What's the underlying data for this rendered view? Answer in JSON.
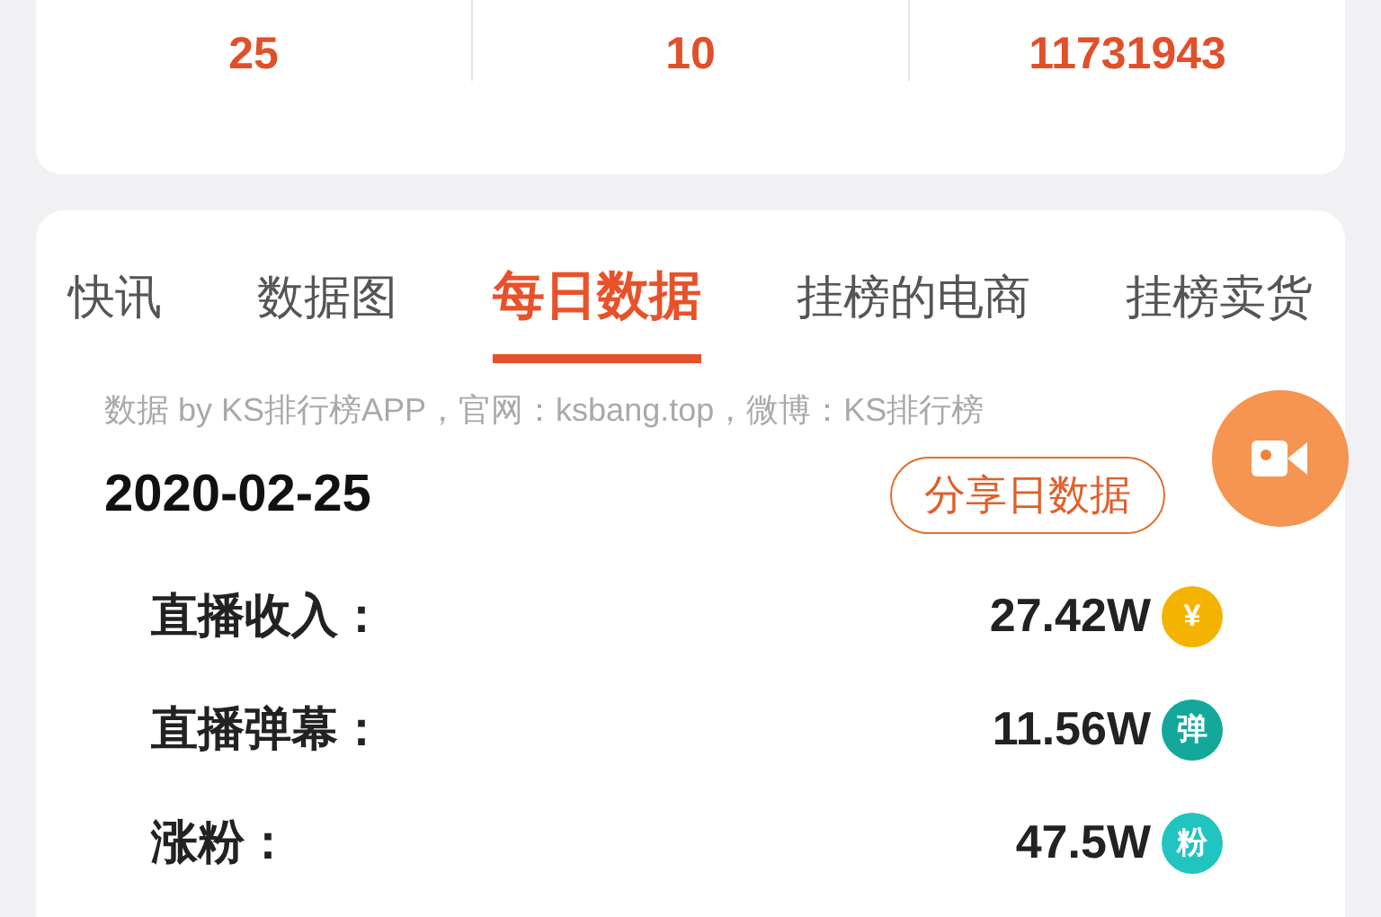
{
  "stats": [
    {
      "value": "25"
    },
    {
      "value": "10"
    },
    {
      "value": "11731943"
    }
  ],
  "tabs": [
    {
      "label": "快讯",
      "selected": false
    },
    {
      "label": "数据图",
      "selected": false
    },
    {
      "label": "每日数据",
      "selected": true
    },
    {
      "label": "挂榜的电商",
      "selected": false
    },
    {
      "label": "挂榜卖货",
      "selected": false
    }
  ],
  "source_note": "数据 by KS排行榜APP，官网：ksbang.top，微博：KS排行榜",
  "date": "2020-02-25",
  "share_button": "分享日数据",
  "metrics": [
    {
      "label": "直播收入：",
      "value": "27.42W",
      "badge": "¥",
      "color": "#f5b301"
    },
    {
      "label": "直播弹幕：",
      "value": "11.56W",
      "badge": "弹",
      "color": "#14a89b"
    },
    {
      "label": "涨粉：",
      "value": "47.5W",
      "badge": "粉",
      "color": "#22c4c0"
    }
  ]
}
